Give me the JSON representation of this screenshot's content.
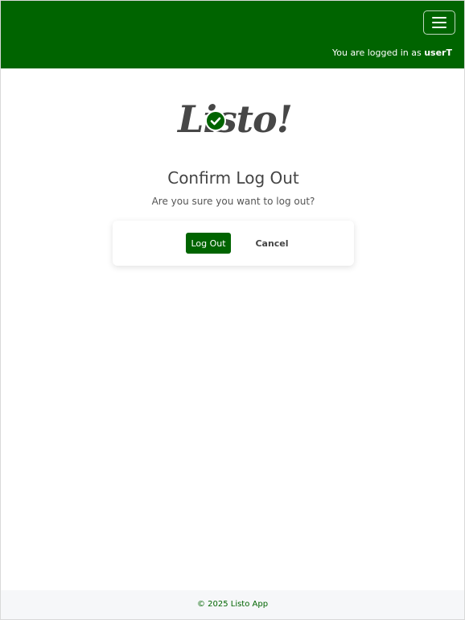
{
  "navbar": {
    "menu_icon": "hamburger-menu-icon",
    "logged_in_prefix": "You are logged in as ",
    "username": "userT",
    "background": "#006400"
  },
  "logo": {
    "text": "Listo!",
    "check_icon": "check-circle-icon"
  },
  "main": {
    "title": "Confirm Log Out",
    "subtitle": "Are you sure you want to log out?",
    "logout_label": "Log Out",
    "cancel_label": "Cancel"
  },
  "footer": {
    "text": "© 2025 Listo App"
  },
  "colors": {
    "accent": "#006400",
    "text": "#444444"
  }
}
